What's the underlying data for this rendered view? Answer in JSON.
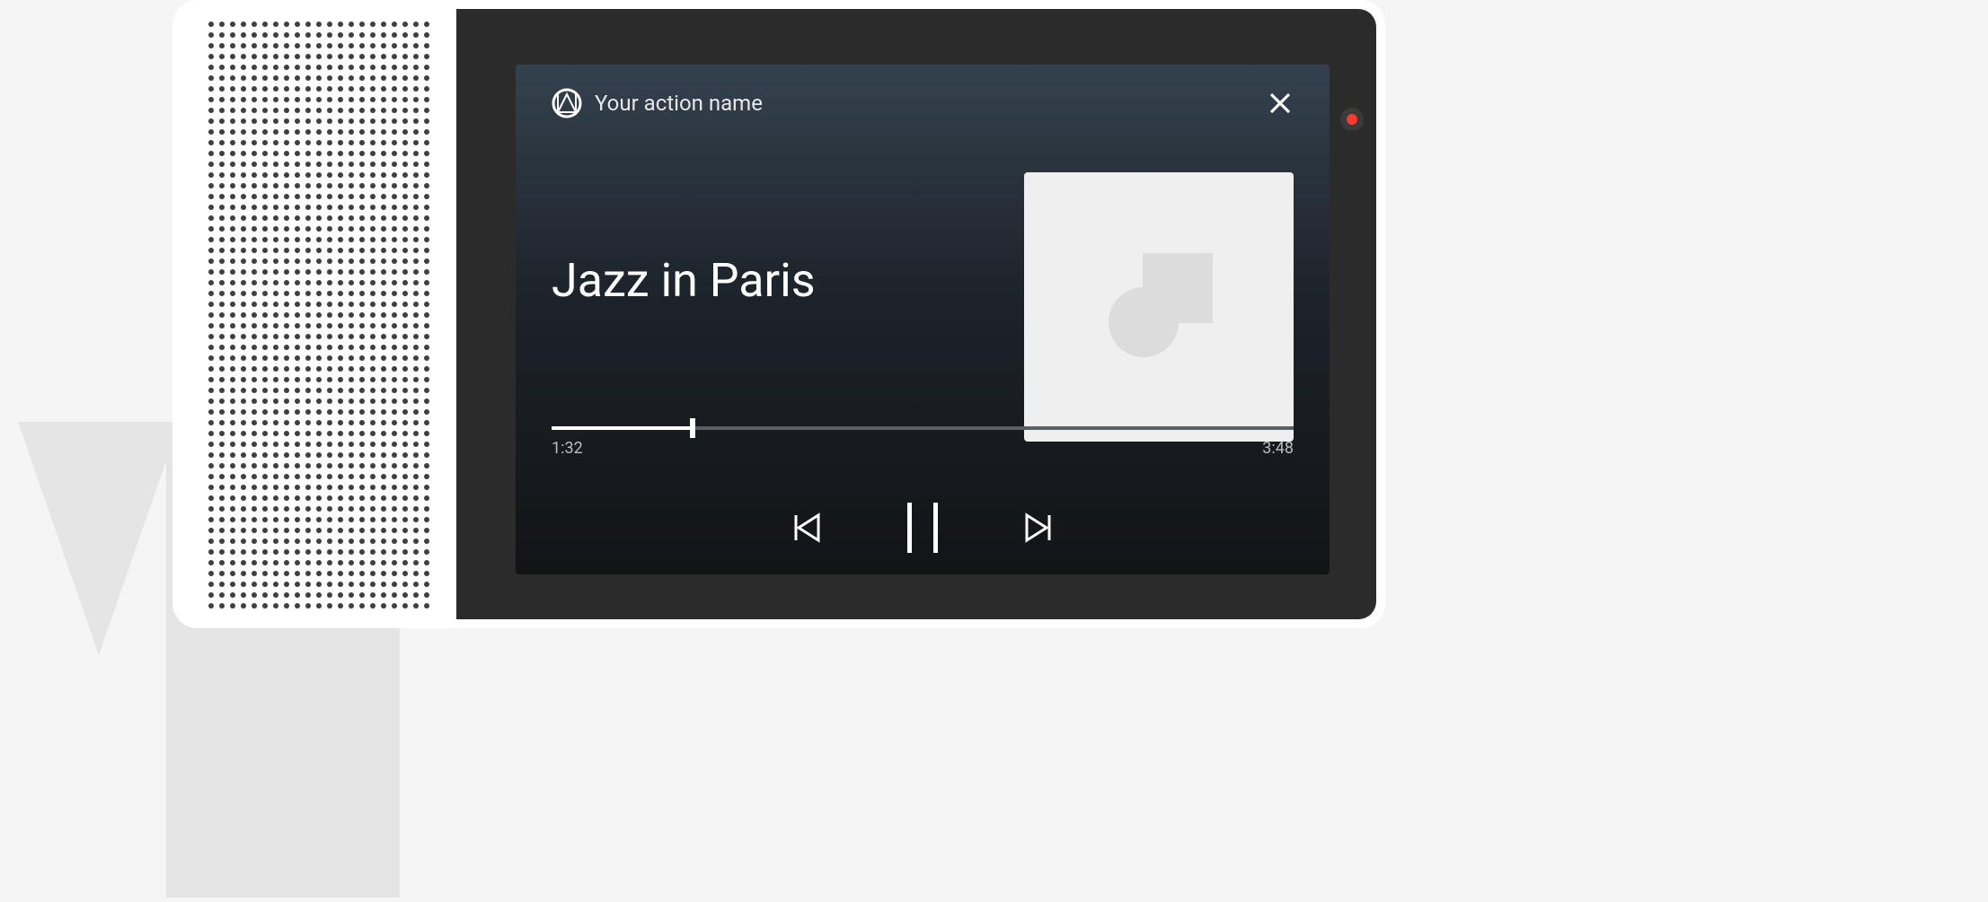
{
  "header": {
    "action_name": "Your action name"
  },
  "track": {
    "title": "Jazz in Paris"
  },
  "progress": {
    "elapsed": "1:32",
    "duration": "3:48",
    "percent": 19
  },
  "icons": {
    "logo": "action-logo-icon",
    "close": "close-icon",
    "prev": "skip-previous-icon",
    "pause": "pause-icon",
    "next": "skip-next-icon",
    "led": "recording-led"
  },
  "colors": {
    "card_gradient_top": "#34414e",
    "card_gradient_bottom": "#121416",
    "led": "#ff3b30",
    "album_bg": "#efefef"
  }
}
